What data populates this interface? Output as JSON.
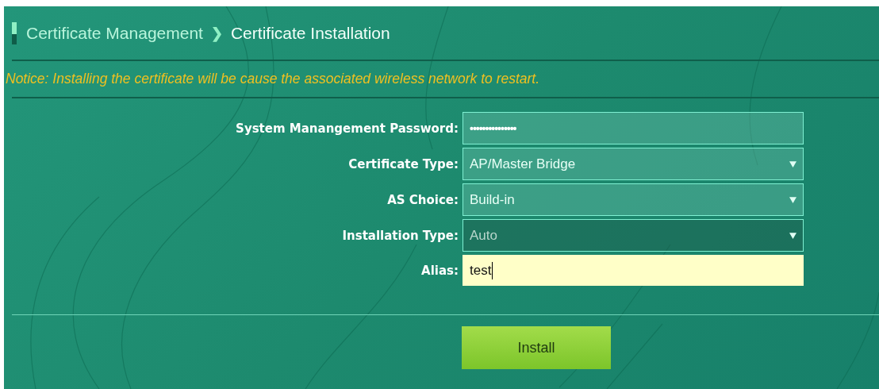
{
  "breadcrumb": {
    "parent": "Certificate Management",
    "separator": "❯",
    "current": "Certificate Installation"
  },
  "notice": "Notice: Installing the certificate will be cause the associated wireless network to restart.",
  "fields": [
    {
      "label": "System Manangement Password:",
      "kind": "password",
      "value": "•••••••••••••••",
      "disabled": false,
      "focused": false
    },
    {
      "label": "Certificate Type:",
      "kind": "select",
      "value": "AP/Master Bridge",
      "disabled": false,
      "focused": false
    },
    {
      "label": "AS Choice:",
      "kind": "select",
      "value": "Build-in",
      "disabled": false,
      "focused": false
    },
    {
      "label": "Installation Type:",
      "kind": "select",
      "value": "Auto",
      "disabled": true,
      "focused": false
    },
    {
      "label": "Alias:",
      "kind": "text",
      "value": "test",
      "disabled": false,
      "focused": true
    }
  ],
  "buttons": [
    "Install"
  ]
}
